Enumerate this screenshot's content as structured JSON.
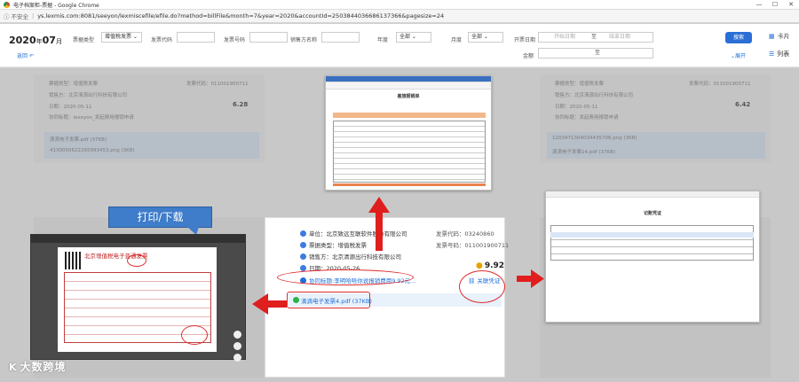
{
  "window": {
    "title": "电子档案柜-票据 - Google Chrome",
    "controls": [
      "—",
      "☐",
      "✕"
    ]
  },
  "address": {
    "security": "不安全",
    "url": "ys.lexmis.com:8081/seeyon/lexmiscefile/efile.do?method=billFile&month=7&year=2020&accountId=2503844036686137366&pagesize=24"
  },
  "header": {
    "year": "2020",
    "year_suffix": "年",
    "month": "07",
    "month_suffix": "月",
    "back_label": "返回",
    "filters": {
      "bill_type_label": "票据类型",
      "bill_type_value": "增值税发票",
      "invoice_code_label": "发票代码",
      "invoice_no_label": "发票号码",
      "seller_label": "销售方名称",
      "year_label": "年度",
      "year_value": "全部",
      "month_label": "月度",
      "month_value": "全部",
      "invoice_date_label": "开票日期",
      "start_placeholder": "开始日期",
      "to": "至",
      "end_placeholder": "结束日期",
      "amount_label": "金额",
      "amount_to": "至"
    },
    "search_label": "搜索",
    "expand_label": "展开",
    "view_card": "卡片",
    "view_list": "列表"
  },
  "bg_cards": [
    {
      "unit": "票据类型：增值税发票",
      "code": "发票代码：011001900711",
      "seller": "销售方：北京清源出行科技有限公司",
      "date": "日期：2020-05-11",
      "amount": "6.28",
      "note": "协同标题：leexyon_发起费用报销申请",
      "file1": "滴滴电子发票.pdf (37KB)",
      "file2": "4130050622265993453.png (3KB)"
    },
    {
      "unit": "票据类型：增值税发票",
      "code": "发票代码：011001900711",
      "seller": "销售方：北京清源出行科技有限公司",
      "date": "日期：2020-05-11",
      "amount": "6.42",
      "note": "协同标题：发起费用报销申请",
      "file1": "1203471304034435706.png (3KB)",
      "file2": "滴滴电子发票14.pdf (37KB)"
    }
  ],
  "center_card": {
    "unit_label": "单位：北京致远互联软件股份有限公司",
    "type_label": "票据类型：增值税发票",
    "seller_label": "销售方：北京清源出行科技有限公司",
    "date_label": "日期：2020-05-26",
    "collab_title": "协同标题:李明哈哈你说报销费用9.92元...",
    "invoice_code": "发票代码：03240860",
    "invoice_no": "发票号码：011001900711",
    "amount": "9.92",
    "assoc_label": "关联凭证",
    "file_name": "滴滴电子发票4.pdf (37KB)"
  },
  "annotation": {
    "print_label": "打印/下载"
  },
  "pdf_preview": {
    "invoice_heading": "北京增值税电子普通发票"
  },
  "form_preview": {
    "title": "差旅报销单"
  },
  "voucher_preview": {
    "title": "记账凭证"
  },
  "watermark": {
    "brand": "大数跨境",
    "mark": "K"
  },
  "colors": {
    "accent": "#2b6fd6",
    "annotation_red": "#e01e1e",
    "label_blue": "#3f7cc9",
    "file_green": "#2ab34a",
    "amount_gold": "#e7a200"
  }
}
